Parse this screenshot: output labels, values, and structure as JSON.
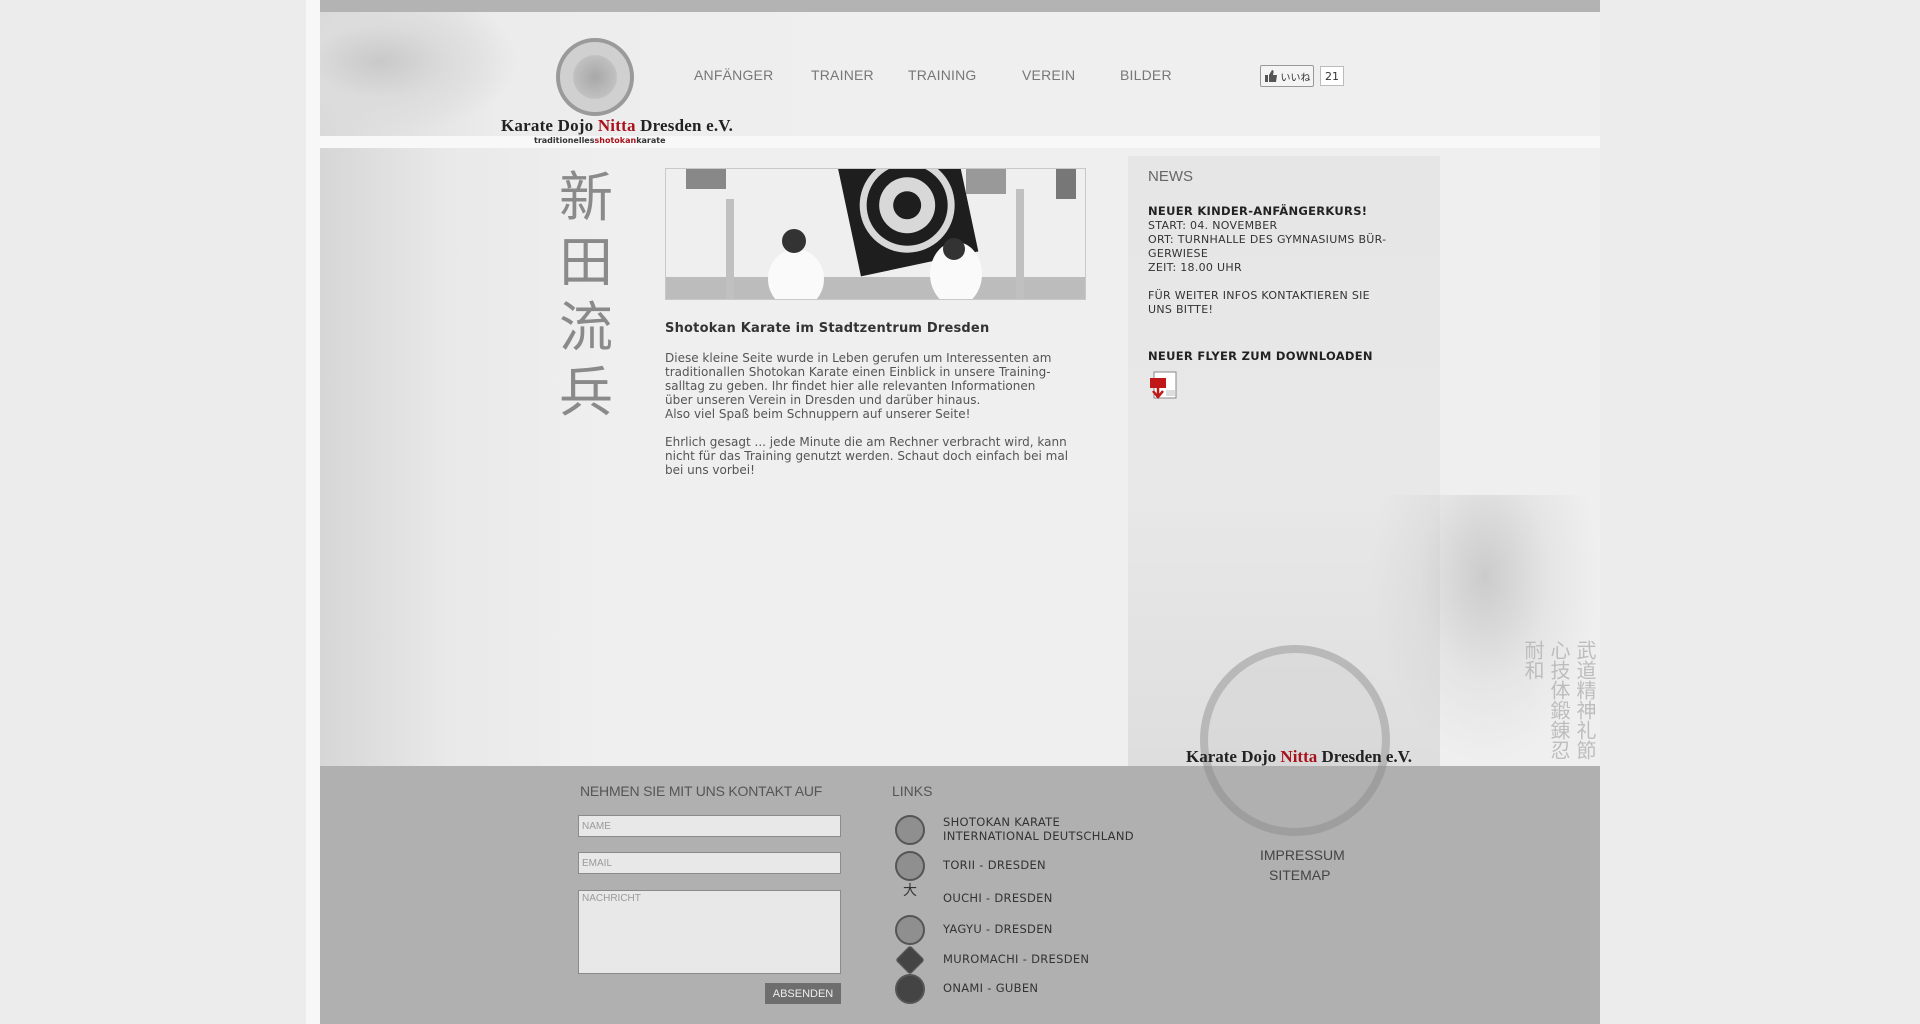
{
  "logo": {
    "title_part1": "Karate Dojo ",
    "title_red": "Nitta",
    "title_part2": " Dresden e.V.",
    "sub_part1": "traditionelles",
    "sub_red": "shotokan",
    "sub_part2": "karate"
  },
  "nav": {
    "items": [
      "ANFÄNGER",
      "TRAINER",
      "TRAINING",
      "VEREIN",
      "BILDER"
    ]
  },
  "like": {
    "label": "いいね",
    "count": "21"
  },
  "main": {
    "title": "Shotokan Karate im Stadtzentrum Dresden",
    "paragraph1": "Diese kleine Seite wurde in Leben gerufen um Interessenten am\ntraditionallen Shotokan Karate einen Einblick in unsere Training-\nsalltag zu geben. Ihr findet hier alle relevanten Informationen\nüber unseren Verein in Dresden und darüber hinaus.\nAlso viel Spaß beim Schnuppern auf unserer Seite!",
    "paragraph2": "Ehrlich gesagt ... jede Minute die am Rechner verbracht wird, kann\nnicht für das Training genutzt werden. Schaut doch einfach bei mal\nbei uns vorbei!"
  },
  "news": {
    "heading": "NEWS",
    "item1_title": "NEUER KINDER-ANFÄNGERKURS!",
    "item1_text": "START: 04. NOVEMBER\nORT: TURNHALLE DES GYMNASIUMS BÜR-\nGERWIESE\nZEIT: 18.00 UHR\n\nFÜR WEITER INFOS KONTAKTIEREN SIE\nUNS BITTE!",
    "item2_title": "NEUER FLYER ZUM DOWNLOADEN"
  },
  "contact": {
    "heading": "NEHMEN SIE MIT UNS KONTAKT AUF",
    "name_placeholder": "NAME",
    "email_placeholder": "EMAIL",
    "message_placeholder": "NACHRICHT",
    "submit_label": "ABSENDEN"
  },
  "links": {
    "heading": "LINKS",
    "items": [
      "SHOTOKAN KARATE\nINTERNATIONAL DEUTSCHLAND",
      "TORII - DRESDEN",
      "OUCHI - DRESDEN",
      "YAGYU - DRESDEN",
      "MUROMACHI - DRESDEN",
      "ONAMI - GUBEN"
    ]
  },
  "footer": {
    "impressum": "IMPRESSUM",
    "sitemap": "SITEMAP"
  },
  "colors": {
    "accent_red": "#a8121c",
    "footer_bg": "#b0b0b0",
    "submit_bg": "#6e6e6e"
  }
}
